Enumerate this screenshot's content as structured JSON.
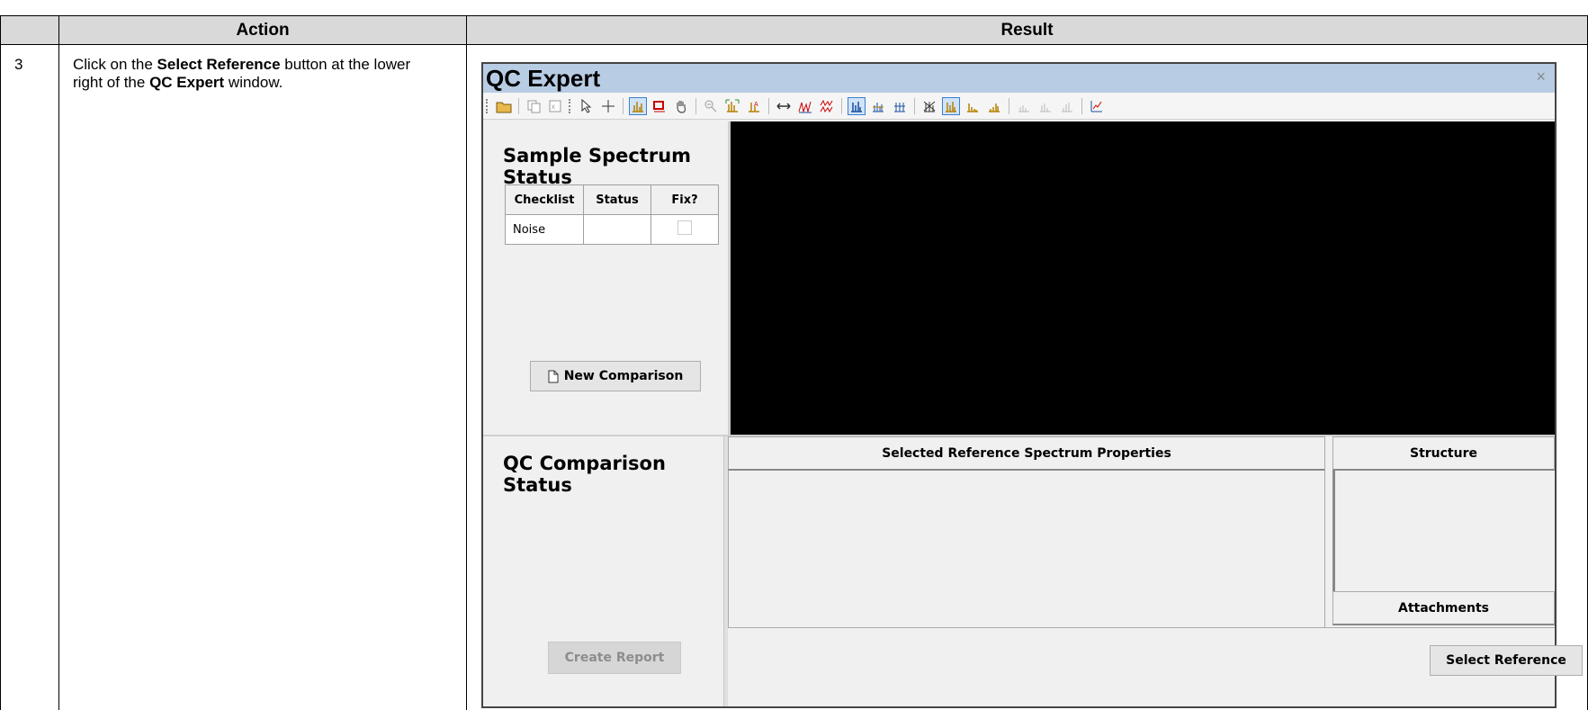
{
  "doc": {
    "col_action": "Action",
    "col_result": "Result",
    "step_number": "3",
    "instruction": {
      "part1": "Click on the ",
      "bold1": "Select Reference",
      "part2": " button at the lower right of the ",
      "bold2": "QC Expert",
      "part3": " window."
    }
  },
  "window": {
    "title": "QC Expert",
    "close_glyph": "×"
  },
  "sample": {
    "heading": "Sample Spectrum Status",
    "columns": [
      "Checklist",
      "Status",
      "Fix?"
    ],
    "rows": [
      {
        "checklist": "Noise",
        "status": "",
        "fix": false
      }
    ],
    "new_comparison": "New Comparison"
  },
  "comparison": {
    "heading": "QC Comparison Status",
    "create_report": "Create Report"
  },
  "reference": {
    "properties_header": "Selected Reference Spectrum Properties",
    "structure_header": "Structure",
    "attachments_header": "Attachments",
    "select_reference": "Select Reference"
  },
  "colors": {
    "titlebar": "#b8cce4",
    "spectrum_bg": "#000000"
  }
}
